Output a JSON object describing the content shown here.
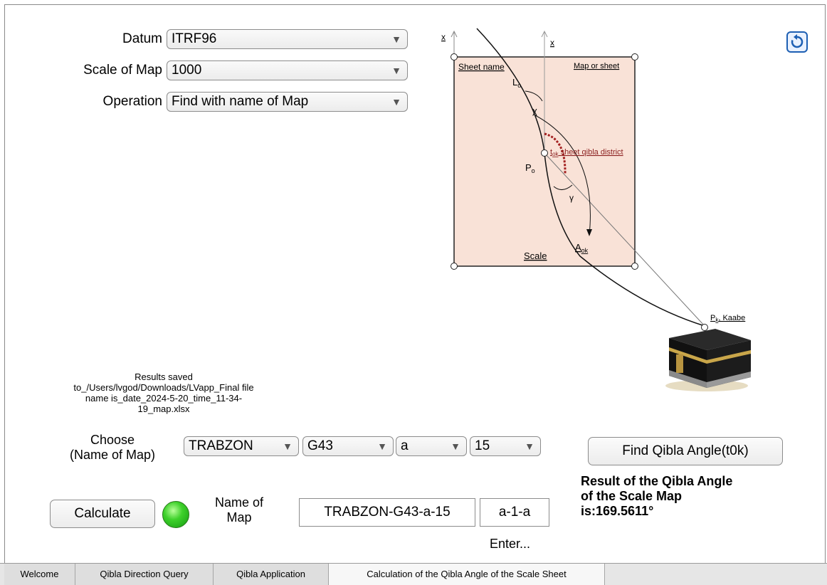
{
  "form": {
    "datum_label": "Datum",
    "datum_value": "ITRF96",
    "scale_label": "Scale of Map",
    "scale_value": "1000",
    "operation_label": "Operation",
    "operation_value": "Find with name of Map"
  },
  "diagram": {
    "x_axis_left": "x",
    "x_axis_right": "x",
    "sheet_name": "Sheet name",
    "map_or_sheet": "Map or sheet",
    "lo": "L",
    "lo_sub": "o",
    "chi": "χ",
    "tok": "t",
    "tok_sub": "ok",
    "tok_text": " sheet qibla  district",
    "po": "P",
    "po_sub": "o",
    "gamma": "γ",
    "aok": "A",
    "aok_sub": "ok",
    "scale": "Scale",
    "pk": "P",
    "pk_sub": "k",
    "kaabe": ", Kaabe"
  },
  "results_saved": {
    "line1": "Results saved",
    "line2": "to_/Users/lvgod/Downloads/LVapp_Final file",
    "line3": "name is_date_2024-5-20_time_11-34-",
    "line4": "19_map.xlsx"
  },
  "choose": {
    "label_line1": "Choose",
    "label_line2": "(Name of Map)",
    "city": "TRABZON",
    "code": "G43",
    "letter": "a",
    "number": "15"
  },
  "find_button": "Find Qibla Angle(t0k)",
  "result": {
    "line1": "Result of the Qibla Angle",
    "line2": "of the Scale Map",
    "line3": "is:169.5611°"
  },
  "calculate_button": "Calculate",
  "name_of_map": {
    "label_line1": "Name of",
    "label_line2": "Map",
    "value": "TRABZON-G43-a-15",
    "sub_value": "a-1-a",
    "enter": "Enter..."
  },
  "tabs": [
    {
      "label": "Welcome"
    },
    {
      "label": "Qibla Direction Query"
    },
    {
      "label": "Qibla Application"
    },
    {
      "label": "Calculation of the Qibla Angle of the Scale Sheet"
    }
  ],
  "status_led_color": "#3ed12b",
  "icons": [
    "refresh-icon",
    "chevron-down-icon",
    "kaaba-image"
  ]
}
